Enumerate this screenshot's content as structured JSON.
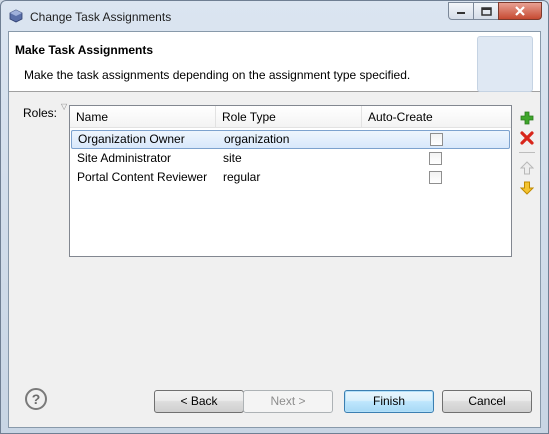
{
  "window": {
    "title": "Change Task Assignments"
  },
  "header": {
    "title": "Make Task Assignments",
    "description": "Make the task assignments depending on the assignment type specified."
  },
  "roles": {
    "label": "Roles:",
    "columns": [
      "Name",
      "Role Type",
      "Auto-Create"
    ],
    "rows": [
      {
        "name": "Organization Owner",
        "role_type": "organization",
        "auto_create": false,
        "selected": true
      },
      {
        "name": "Site Administrator",
        "role_type": "site",
        "auto_create": false,
        "selected": false
      },
      {
        "name": "Portal Content Reviewer",
        "role_type": "regular",
        "auto_create": false,
        "selected": false
      }
    ]
  },
  "side_buttons": [
    "add-icon",
    "delete-icon",
    "move-up-icon",
    "move-down-icon"
  ],
  "footer": {
    "help_glyph": "?",
    "back_label": "< Back",
    "next_label": "Next >",
    "finish_label": "Finish",
    "cancel_label": "Cancel",
    "next_enabled": false
  },
  "colors": {
    "add": "#3fa62b",
    "delete": "#d8261b",
    "move_down": "#e0a400",
    "disabled": "#b8b8b8"
  }
}
